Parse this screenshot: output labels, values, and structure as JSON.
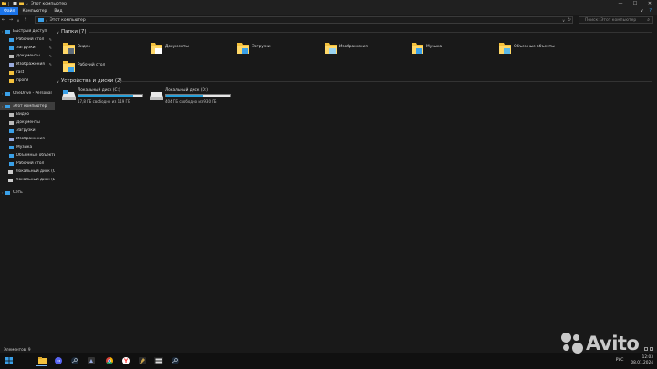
{
  "window": {
    "title": "Этот компьютер",
    "controls": {
      "minimize": "—",
      "maximize": "☐",
      "close": "✕"
    }
  },
  "ribbon": {
    "tabs": [
      {
        "label": "Файл",
        "active": true
      },
      {
        "label": "Компьютер",
        "active": false
      },
      {
        "label": "Вид",
        "active": false
      }
    ]
  },
  "address": {
    "path": "Этот компьютер",
    "search_placeholder": "Поиск: Этот компьютер"
  },
  "sidebar": {
    "items": [
      {
        "label": "Быстрый доступ",
        "icon": "star-icon",
        "pinned": false,
        "indent": 0
      },
      {
        "label": "Рабочий стол",
        "icon": "desktop-icon",
        "pinned": true,
        "indent": 1
      },
      {
        "label": "Загрузки",
        "icon": "download-icon",
        "pinned": true,
        "indent": 1
      },
      {
        "label": "Документы",
        "icon": "documents-icon",
        "pinned": true,
        "indent": 1
      },
      {
        "label": "Изображения",
        "icon": "pictures-icon",
        "pinned": true,
        "indent": 1
      },
      {
        "label": "rast",
        "icon": "folder-icon",
        "pinned": false,
        "indent": 1
      },
      {
        "label": "проги",
        "icon": "folder-icon",
        "pinned": false,
        "indent": 1
      },
      {
        "label": "",
        "icon": "",
        "pinned": false,
        "indent": 0,
        "spacer": true
      },
      {
        "label": "OneDrive - Personal",
        "icon": "cloud-icon",
        "pinned": false,
        "indent": 0
      },
      {
        "label": "",
        "icon": "",
        "pinned": false,
        "indent": 0,
        "spacer": true
      },
      {
        "label": "Этот компьютер",
        "icon": "computer-icon",
        "pinned": false,
        "indent": 0,
        "active": true
      },
      {
        "label": "Видео",
        "icon": "video-icon",
        "pinned": false,
        "indent": 1
      },
      {
        "label": "Документы",
        "icon": "documents-icon",
        "pinned": false,
        "indent": 1
      },
      {
        "label": "Загрузки",
        "icon": "download-icon",
        "pinned": false,
        "indent": 1
      },
      {
        "label": "Изображения",
        "icon": "pictures-icon",
        "pinned": false,
        "indent": 1
      },
      {
        "label": "Музыка",
        "icon": "music-icon",
        "pinned": false,
        "indent": 1
      },
      {
        "label": "Объемные объекты",
        "icon": "3d-objects-icon",
        "pinned": false,
        "indent": 1
      },
      {
        "label": "Рабочий стол",
        "icon": "desktop-icon",
        "pinned": false,
        "indent": 1
      },
      {
        "label": "Локальный диск (C:)",
        "icon": "drive-icon",
        "pinned": false,
        "indent": 1
      },
      {
        "label": "Локальный диск (D:)",
        "icon": "drive-icon",
        "pinned": false,
        "indent": 1
      },
      {
        "label": "",
        "icon": "",
        "pinned": false,
        "indent": 0,
        "spacer": true
      },
      {
        "label": "Сеть",
        "icon": "network-icon",
        "pinned": false,
        "indent": 0
      }
    ]
  },
  "folders_group": {
    "title": "Папки (7)",
    "items": [
      {
        "label": "Видео",
        "icon": "video-folder-icon"
      },
      {
        "label": "Документы",
        "icon": "documents-folder-icon"
      },
      {
        "label": "Загрузки",
        "icon": "downloads-folder-icon"
      },
      {
        "label": "Изображения",
        "icon": "pictures-folder-icon"
      },
      {
        "label": "Музыка",
        "icon": "music-folder-icon"
      },
      {
        "label": "Объемные объекты",
        "icon": "3d-objects-folder-icon"
      },
      {
        "label": "Рабочий стол",
        "icon": "desktop-folder-icon"
      }
    ]
  },
  "drives_group": {
    "title": "Устройства и диски (2)",
    "items": [
      {
        "label": "Локальный диск (C:)",
        "free_text": "17,8 ГБ свободно из 119 ГБ",
        "used_fraction": 0.85
      },
      {
        "label": "Локальный диск (D:)",
        "free_text": "404 ГБ свободно из 930 ГБ",
        "used_fraction": 0.57
      }
    ]
  },
  "status": {
    "text": "Элементов: 9"
  },
  "taskbar": {
    "lang": "РУС",
    "time": "12:03",
    "date": "08.01.2024"
  },
  "watermark": {
    "text": "Avito"
  },
  "colors": {
    "accent": "#1a73e8",
    "drive_fill": "#26a0da",
    "folder_yellow": "#f4c13d"
  }
}
